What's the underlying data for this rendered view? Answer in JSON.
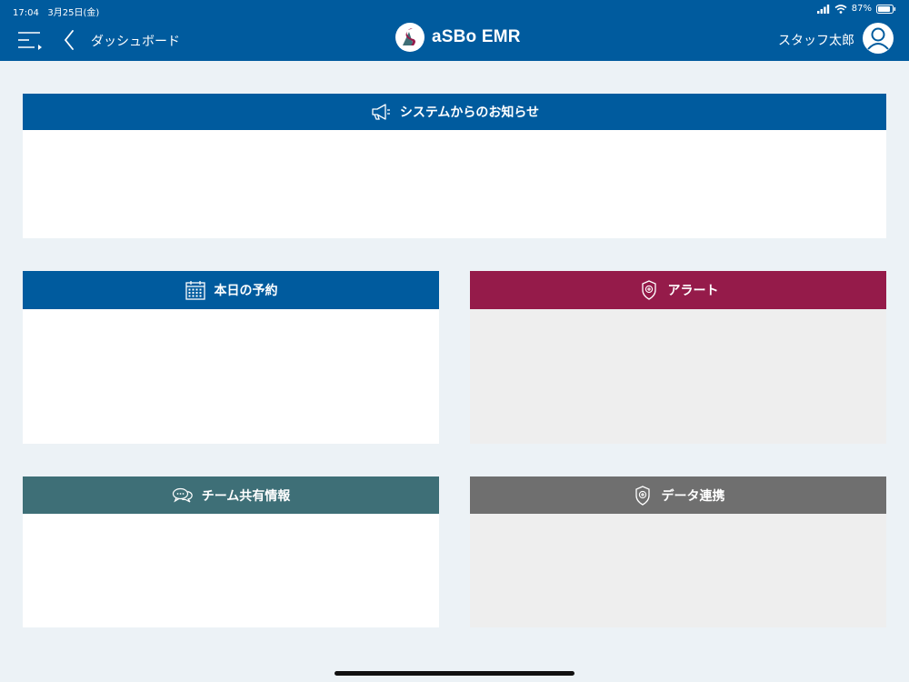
{
  "status_bar": {
    "time": "17:04",
    "date": "3月25日(金)",
    "battery_percent": "87%",
    "battery_level": 0.87
  },
  "header": {
    "back_label": "ダッシュボード",
    "app_name": "aSBo EMR",
    "user_name": "スタッフ太郎",
    "background_color": "#005b9e"
  },
  "panels": {
    "notice": {
      "title": "システムからのお知らせ",
      "icon": "megaphone-icon",
      "color": "#005b9e"
    },
    "appointments": {
      "title": "本日の予約",
      "icon": "calendar-icon",
      "color": "#005b9e"
    },
    "alerts": {
      "title": "アラート",
      "icon": "shield-plus-icon",
      "color": "#951b4a"
    },
    "team": {
      "title": "チーム共有情報",
      "icon": "chat-bubbles-icon",
      "color": "#3e6f77"
    },
    "data_link": {
      "title": "データ連携",
      "icon": "shield-plus-icon",
      "color": "#6f6f6f"
    }
  }
}
